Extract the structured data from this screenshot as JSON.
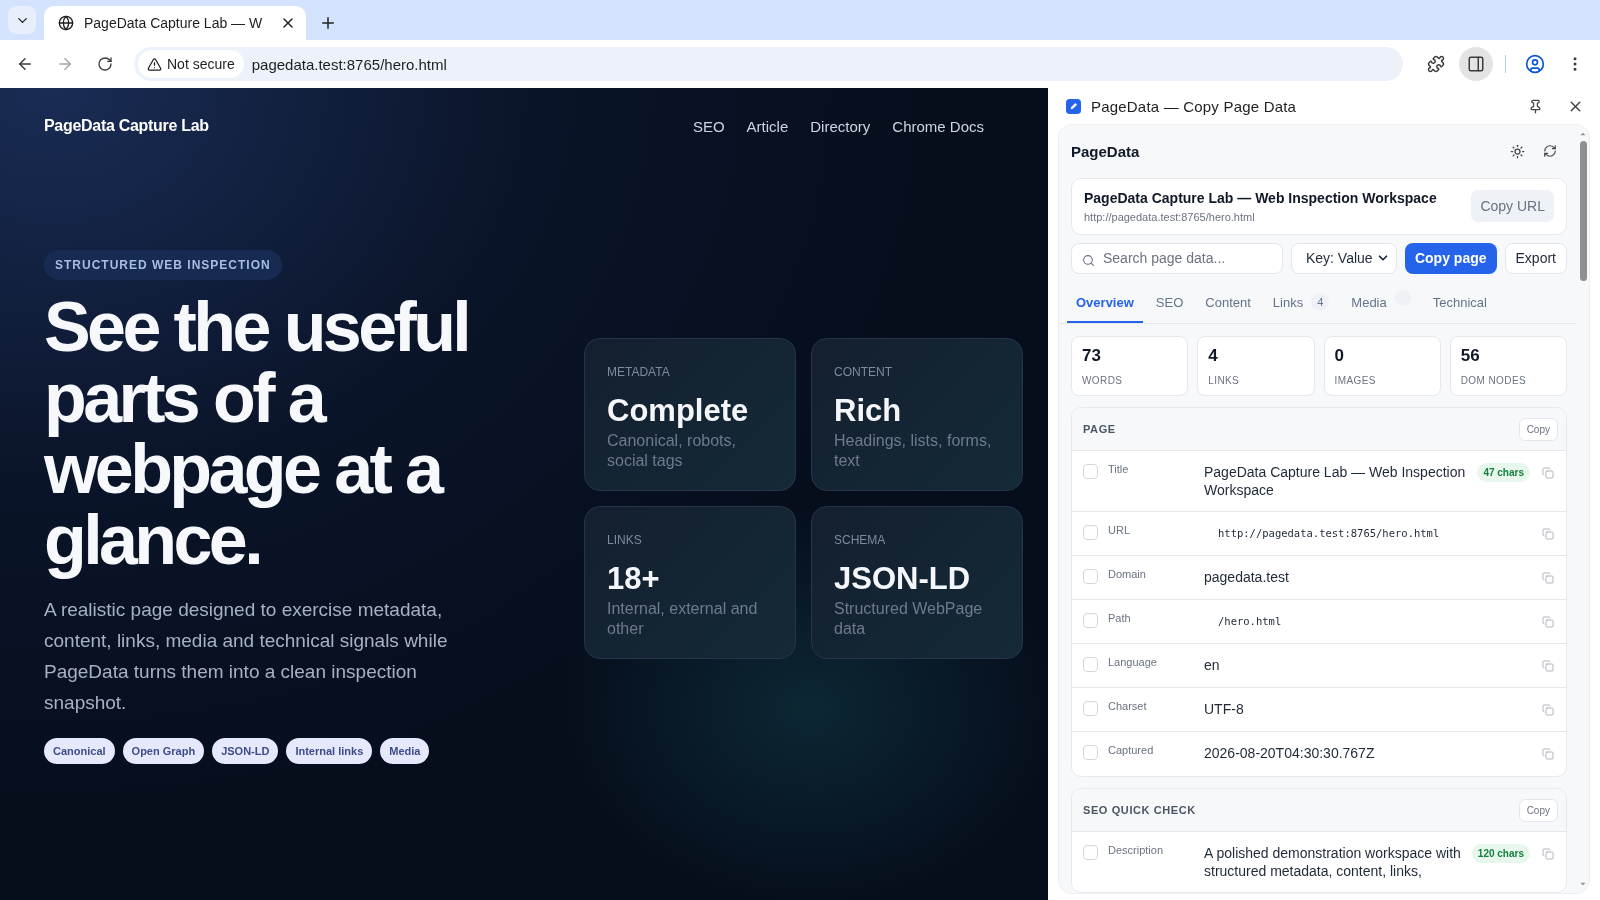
{
  "browser": {
    "tabs": [
      {
        "title": "PageData Capture Lab — W",
        "selected": true
      }
    ],
    "security": "Not secure",
    "url": "pagedata.test:8765/hero.html"
  },
  "page": {
    "brand": "PageData Capture Lab",
    "nav": [
      "SEO",
      "Article",
      "Directory",
      "Chrome Docs"
    ],
    "eyebrow": "STRUCTURED WEB INSPECTION",
    "heading": "See the useful parts of a webpage at a glance.",
    "lead": "A realistic page designed to exercise metadata, content, links, media and technical signals while PageData turns them into a clean inspection snapshot.",
    "tags": [
      "Canonical",
      "Open Graph",
      "JSON-LD",
      "Internal links",
      "Media"
    ],
    "cards": [
      {
        "label": "METADATA",
        "value": "Complete",
        "note": "Canonical, robots, social tags"
      },
      {
        "label": "CONTENT",
        "value": "Rich",
        "note": "Headings, lists, forms, text"
      },
      {
        "label": "LINKS",
        "value": "18+",
        "note": "Internal, external and other"
      },
      {
        "label": "SCHEMA",
        "value": "JSON-LD",
        "note": "Structured WebPage data"
      }
    ]
  },
  "side_panel": {
    "title": "PageData — Copy Page Data",
    "app_name": "PageData",
    "page_title": "PageData Capture Lab — Web Inspection Workspace",
    "page_url": "http://pagedata.test:8765/hero.html",
    "copy_url": "Copy URL",
    "search": {
      "placeholder": "Search page data..."
    },
    "format": "Key: Value",
    "copy_page": "Copy page",
    "export": "Export",
    "tabs": [
      {
        "label": "Overview",
        "selected": true
      },
      {
        "label": "SEO",
        "selected": false
      },
      {
        "label": "Content",
        "selected": false
      },
      {
        "label": "Links",
        "count": "4",
        "selected": false
      },
      {
        "label": "Media",
        "empty_badge": true,
        "selected": false
      },
      {
        "label": "Technical",
        "selected": false
      }
    ],
    "stats": [
      {
        "value": "73",
        "label": "WORDS"
      },
      {
        "value": "4",
        "label": "LINKS"
      },
      {
        "value": "0",
        "label": "IMAGES"
      },
      {
        "value": "56",
        "label": "DOM NODES"
      }
    ],
    "sections": [
      {
        "title": "PAGE",
        "copy": "Copy",
        "rows": [
          {
            "label": "Title",
            "value": "PageData Capture Lab — Web Inspection Workspace",
            "kind": "text",
            "badge": "47 chars",
            "checked": false
          },
          {
            "label": "URL",
            "value": "http://pagedata.test:8765/hero.html",
            "kind": "code",
            "checked": false
          },
          {
            "label": "Domain",
            "value": "pagedata.test",
            "kind": "text",
            "checked": false
          },
          {
            "label": "Path",
            "value": "/hero.html",
            "kind": "code",
            "checked": false
          },
          {
            "label": "Language",
            "value": "en",
            "kind": "text",
            "checked": false
          },
          {
            "label": "Charset",
            "value": "UTF-8",
            "kind": "text",
            "checked": false
          },
          {
            "label": "Captured",
            "value": "2026-08-20T04:30:30.767Z",
            "kind": "text",
            "checked": false
          }
        ]
      },
      {
        "title": "SEO QUICK CHECK",
        "copy": "Copy",
        "rows": [
          {
            "label": "Description",
            "value": "A polished demonstration workspace with structured metadata, content, links,",
            "kind": "text",
            "badge": "120 chars",
            "checked": false
          }
        ]
      }
    ]
  }
}
